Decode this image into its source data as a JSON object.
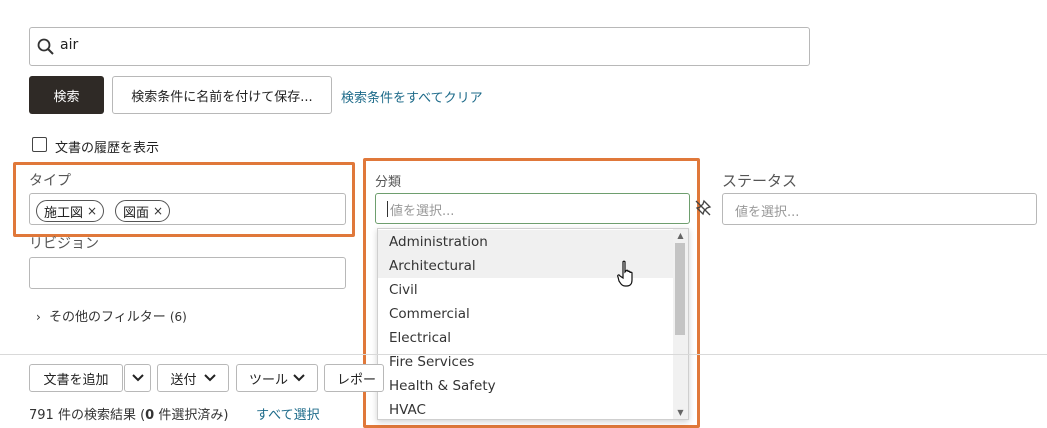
{
  "search": {
    "value": "air"
  },
  "actions": {
    "search_label": "検索",
    "save_label": "検索条件に名前を付けて保存...",
    "clear_label": "検索条件をすべてクリア"
  },
  "history_checkbox": {
    "label": "文書の履歴を表示",
    "checked": false
  },
  "filters": {
    "type": {
      "label": "タイプ",
      "chips": [
        "施工図",
        "図面"
      ]
    },
    "category": {
      "label": "分類",
      "placeholder": "値を選択...",
      "options": [
        "Administration",
        "Architectural",
        "Civil",
        "Commercial",
        "Electrical",
        "Fire Services",
        "Health & Safety",
        "HVAC"
      ],
      "hovered_option": "Architectural"
    },
    "status": {
      "label": "ステータス",
      "placeholder": "値を選択..."
    },
    "revision": {
      "label": "リビジョン",
      "value": ""
    },
    "more_filters": {
      "label": "その他のフィルター",
      "count": "(6)"
    }
  },
  "toolbar": {
    "add_doc_label": "文書を追加",
    "send_label": "送付",
    "tools_label": "ツール",
    "report_label": "レポー"
  },
  "results": {
    "count_text": "791 件の検索結果 (",
    "selected_count": "0",
    "selected_text": " 件選択済み)",
    "select_all_label": "すべて選択"
  },
  "colors": {
    "highlight": "#e0783a",
    "primary_button": "#2f2a26",
    "link": "#1e6b8a"
  }
}
